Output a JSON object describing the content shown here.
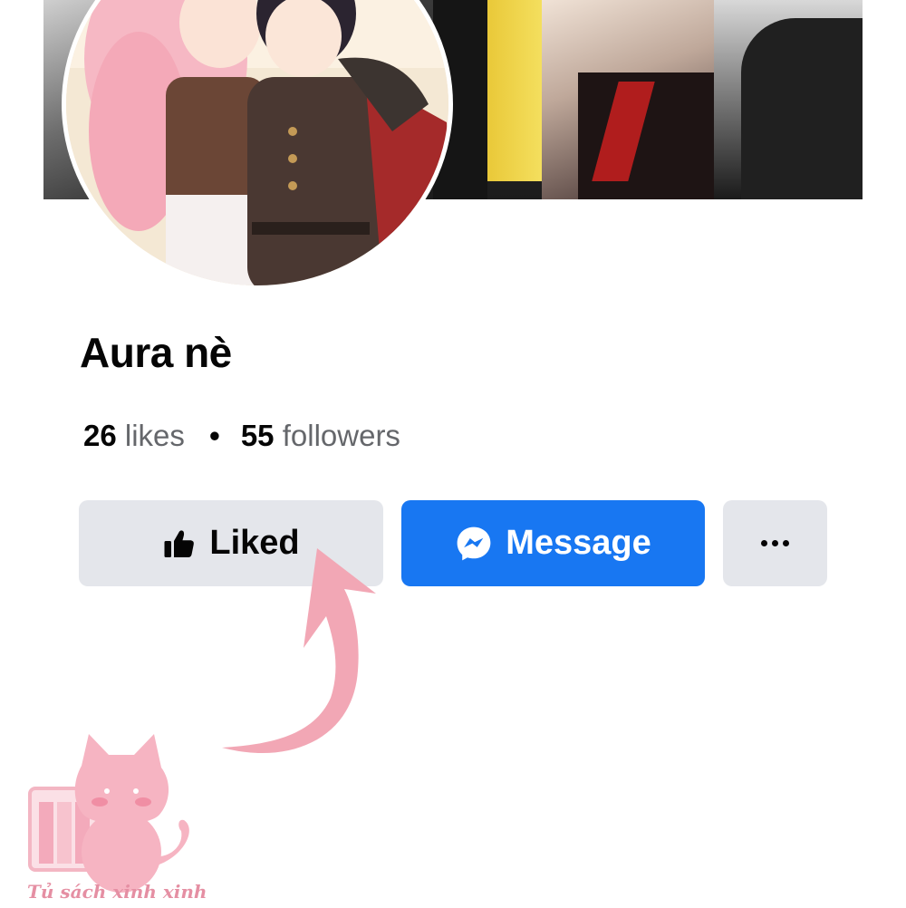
{
  "profile": {
    "name": "Aura nè",
    "likes_count": "26",
    "likes_label": "likes",
    "separator": "•",
    "followers_count": "55",
    "followers_label": "followers"
  },
  "actions": {
    "liked_label": "Liked",
    "message_label": "Message",
    "more_icon": "more-horizontal-icon"
  },
  "watermark": {
    "text": "Tủ sách xinh xinh"
  },
  "colors": {
    "message_button": "#1877f2",
    "secondary_button": "#e4e6eb",
    "arrow": "#f2a7b5"
  }
}
